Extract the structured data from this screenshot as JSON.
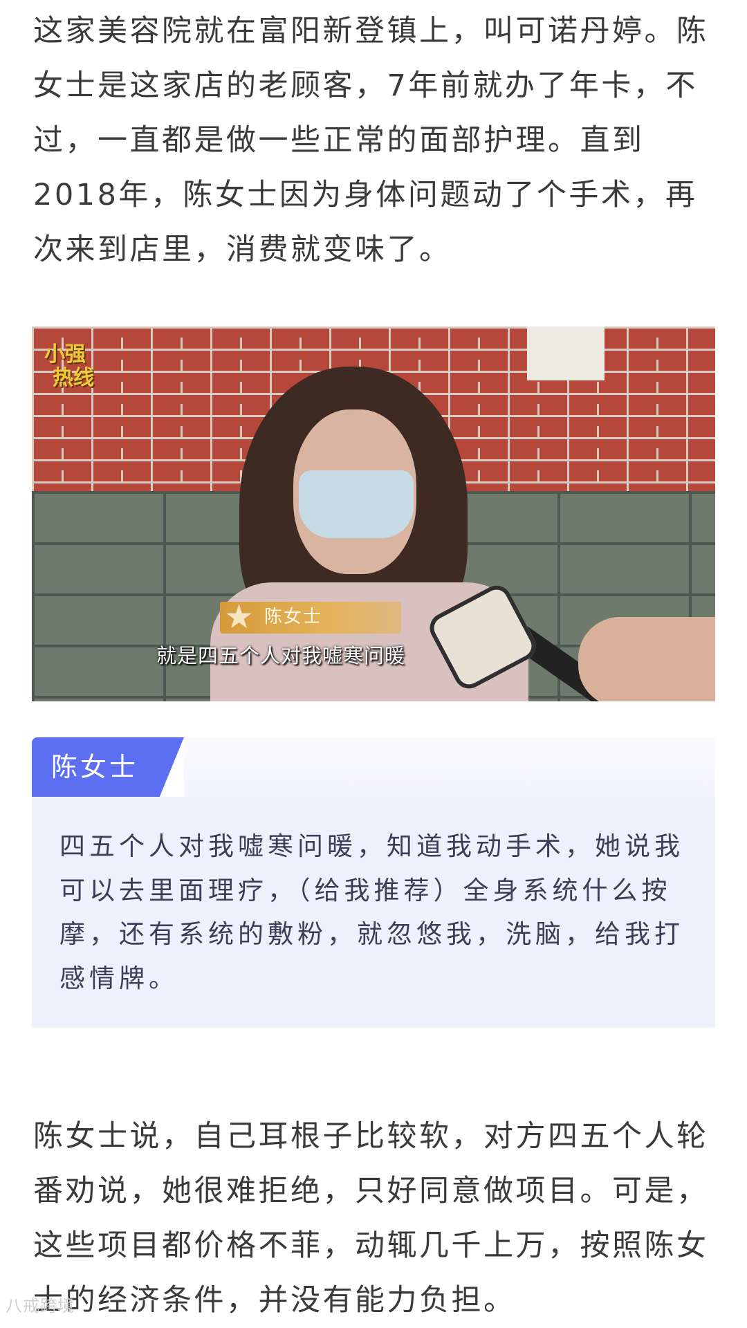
{
  "article": {
    "paragraph_1": "这家美容院就在富阳新登镇上，叫可诺丹婷。陈女士是这家店的老顾客，7年前就办了年卡，不过，一直都是做一些正常的面部护理。直到2018年，陈女士因为身体问题动了个手术，再次来到店里，消费就变味了。",
    "photo": {
      "logo_line_1": "小强",
      "logo_line_2": "热线",
      "lower_third_name": "陈女士",
      "subtitle": "就是四五个人对我嘘寒问暖"
    },
    "quote": {
      "speaker": "陈女士",
      "text": "四五个人对我嘘寒问暖，知道我动手术，她说我可以去里面理疗，（给我推荐）全身系统什么按摩，还有系统的敷粉，就忽悠我，洗脑，给我打感情牌。"
    },
    "paragraph_2": "陈女士说，自己耳根子比较软，对方四五个人轮番劝说，她很难拒绝，只好同意做项目。可是，这些项目都价格不菲，动辄几千上万，按照陈女士的经济条件，并没有能力负担。",
    "watermark": "八戒跨境"
  }
}
